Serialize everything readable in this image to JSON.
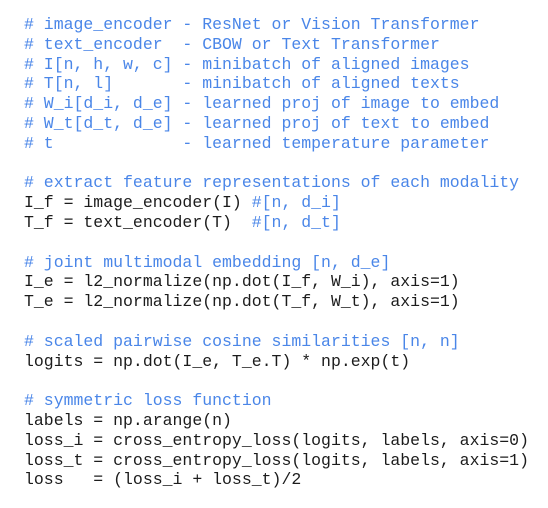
{
  "colors": {
    "comment": "#4a86e8",
    "code": "#1c1c1c"
  },
  "lines": [
    [
      {
        "t": "# image_encoder - ResNet or Vision Transformer",
        "k": "cm"
      }
    ],
    [
      {
        "t": "# text_encoder  - CBOW or Text Transformer",
        "k": "cm"
      }
    ],
    [
      {
        "t": "# I[n, h, w, c] - minibatch of aligned images",
        "k": "cm"
      }
    ],
    [
      {
        "t": "# T[n, l]       - minibatch of aligned texts",
        "k": "cm"
      }
    ],
    [
      {
        "t": "# W_i[d_i, d_e] - learned proj of image to embed",
        "k": "cm"
      }
    ],
    [
      {
        "t": "# W_t[d_t, d_e] - learned proj of text to embed",
        "k": "cm"
      }
    ],
    [
      {
        "t": "# t             - learned temperature parameter",
        "k": "cm"
      }
    ],
    [],
    [
      {
        "t": "# extract feature representations of each modality",
        "k": "cm"
      }
    ],
    [
      {
        "t": "I_f = image_encoder(I) ",
        "k": "cd"
      },
      {
        "t": "#[n, d_i]",
        "k": "cm"
      }
    ],
    [
      {
        "t": "T_f = text_encoder(T)  ",
        "k": "cd"
      },
      {
        "t": "#[n, d_t]",
        "k": "cm"
      }
    ],
    [],
    [
      {
        "t": "# joint multimodal embedding [n, d_e]",
        "k": "cm"
      }
    ],
    [
      {
        "t": "I_e = l2_normalize(np.dot(I_f, W_i), axis=1)",
        "k": "cd"
      }
    ],
    [
      {
        "t": "T_e = l2_normalize(np.dot(T_f, W_t), axis=1)",
        "k": "cd"
      }
    ],
    [],
    [
      {
        "t": "# scaled pairwise cosine similarities [n, n]",
        "k": "cm"
      }
    ],
    [
      {
        "t": "logits = np.dot(I_e, T_e.T) * np.exp(t)",
        "k": "cd"
      }
    ],
    [],
    [
      {
        "t": "# symmetric loss function",
        "k": "cm"
      }
    ],
    [
      {
        "t": "labels = np.arange(n)",
        "k": "cd"
      }
    ],
    [
      {
        "t": "loss_i = cross_entropy_loss(logits, labels, axis=0)",
        "k": "cd"
      }
    ],
    [
      {
        "t": "loss_t = cross_entropy_loss(logits, labels, axis=1)",
        "k": "cd"
      }
    ],
    [
      {
        "t": "loss   = (loss_i + loss_t)/2",
        "k": "cd"
      }
    ]
  ]
}
